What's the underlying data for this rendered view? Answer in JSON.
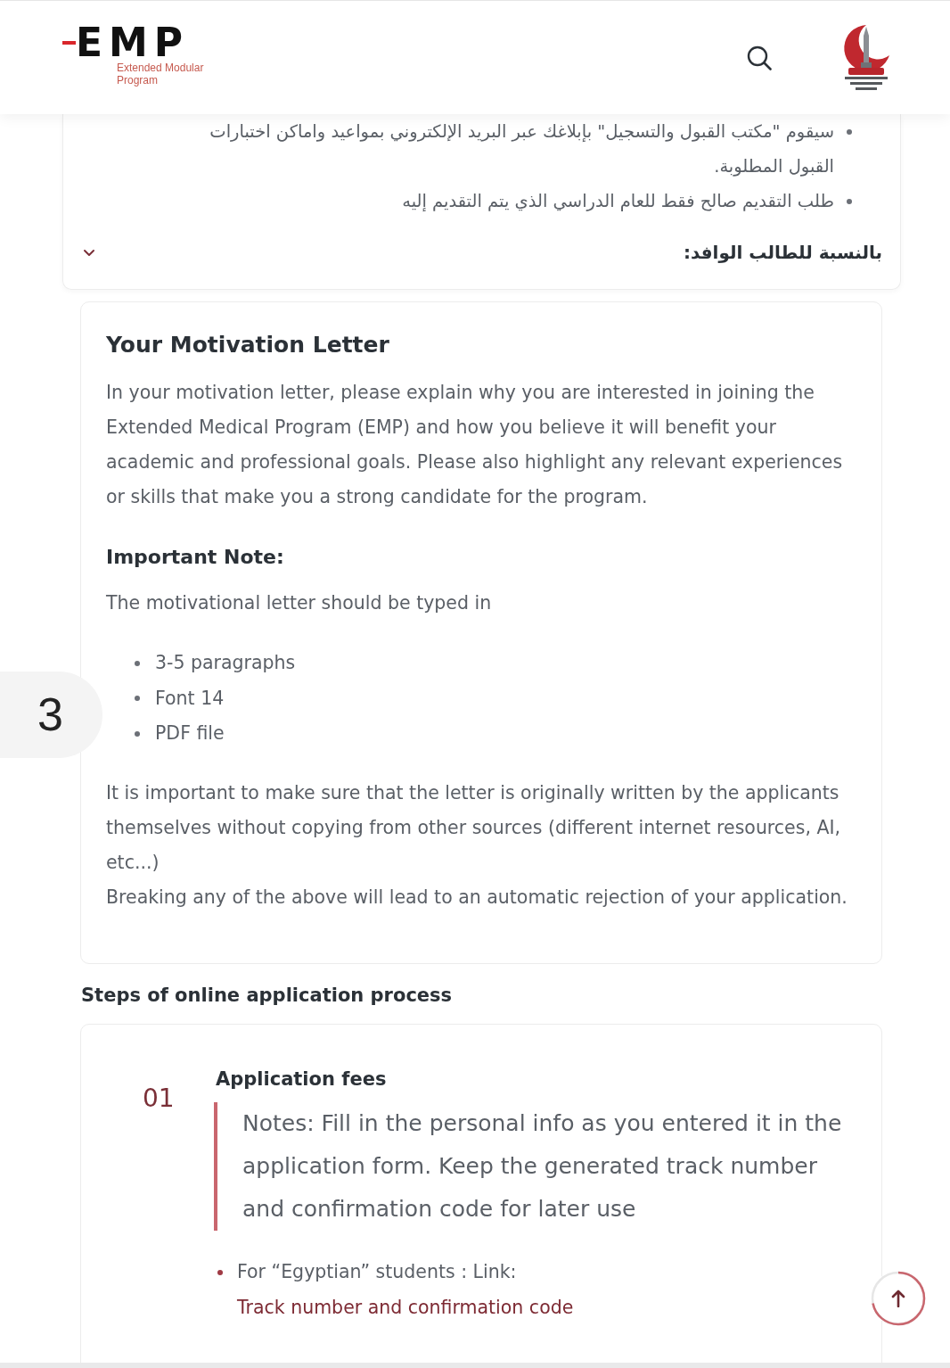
{
  "header": {
    "logo": {
      "wordmark": "EMP",
      "tagline": "Extended Modular Program"
    }
  },
  "requirements_panel": {
    "bullets": [
      "سيقوم \"مكتب القبول والتسجيل\" بإبلاغك عبر البريد الإلكتروني بمواعيد واماكن اختبارات القبول المطلوبة.",
      "طلب التقديم صالح فقط للعام الدراسي الذي يتم التقديم إليه"
    ],
    "accordion": {
      "title": "بالنسبة للطالب الوافد:",
      "expanded": false
    }
  },
  "motivation_letter": {
    "title": "Your Motivation Letter",
    "intro": "In your motivation letter, please explain why you are interested in joining the Extended Medical Program (EMP) and how you believe it will benefit your academic and professional goals. Please also highlight any relevant experiences or skills that make you a strong candidate for the program.",
    "note_title": "Important Note:",
    "note_text": "The motivational letter should be typed in",
    "requirements": [
      "3-5 paragraphs",
      "Font 14",
      "PDF file"
    ],
    "originality": "It is important to make sure that the letter is originally written by the applicants themselves without copying from other sources (different internet resources, AI, etc...)",
    "warning": "Breaking any of the above will lead to an automatic rejection of your application."
  },
  "steps": {
    "title": "Steps of online application process",
    "items": [
      {
        "number": "01",
        "title": "Application fees",
        "note": "Notes: Fill in the personal info as you entered it in the application form. Keep the generated track number and confirmation code for later use",
        "bullets": [
          {
            "text": "For “Egyptian” students : Link:",
            "link": "Track number and confirmation code"
          }
        ]
      }
    ]
  },
  "side_tab": {
    "label": "3"
  }
}
